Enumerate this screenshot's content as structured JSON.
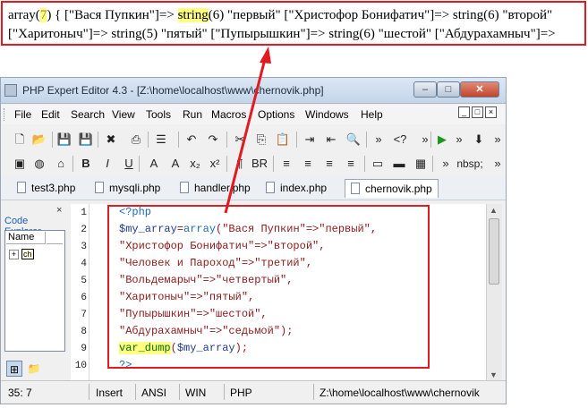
{
  "output": {
    "line1": [
      {
        "t": "array(",
        "c": ""
      },
      {
        "t": "7",
        "c": "hl"
      },
      {
        "t": ") { [\"Вася Пупкин\"]=> ",
        "c": ""
      },
      {
        "t": "string",
        "c": "hl2"
      },
      {
        "t": "(6) \"первый\" [\"Христофор Бонифатич\"]=> string(6) \"второй\"",
        "c": ""
      }
    ],
    "line2": "[\"Харитоныч\"]=> string(5) \"пятый\" [\"Пупырышкин\"]=> string(6) \"шестой\" [\"Абдурахамныч\"]=>"
  },
  "window": {
    "title": "PHP Expert Editor 4.3 - [Z:\\home\\localhost\\www\\chernovik.php]",
    "controls": {
      "minimize": "–",
      "maximize": "□",
      "close": "✕"
    }
  },
  "menu": [
    "File",
    "Edit",
    "Search",
    "View",
    "Tools",
    "Run",
    "Macros",
    "Options",
    "Windows",
    "Help"
  ],
  "mdi_controls": [
    "_",
    "□",
    "×"
  ],
  "toolbar1": [
    {
      "icon": "new-file-icon",
      "glyph": "🗋"
    },
    {
      "icon": "open-folder-icon",
      "glyph": "📂"
    },
    {
      "icon": "save-icon",
      "glyph": "💾"
    },
    {
      "icon": "save-all-icon",
      "glyph": "💾"
    },
    {
      "icon": "close-file-icon",
      "glyph": "✖"
    },
    {
      "icon": "print-icon",
      "glyph": "⎙"
    },
    {
      "icon": "list-icon",
      "glyph": "☰"
    },
    {
      "icon": "undo-icon",
      "glyph": "↶"
    },
    {
      "icon": "redo-icon",
      "glyph": "↷"
    },
    {
      "icon": "cut-icon",
      "glyph": "✂"
    },
    {
      "icon": "copy-icon",
      "glyph": "⎘"
    },
    {
      "icon": "paste-icon",
      "glyph": "📋"
    },
    {
      "icon": "indent-icon",
      "glyph": "⇥"
    },
    {
      "icon": "outdent-icon",
      "glyph": "⇤"
    },
    {
      "icon": "find-icon",
      "glyph": "🔍"
    },
    {
      "icon": "more-icon",
      "glyph": "»"
    },
    {
      "icon": "php-tag-icon",
      "glyph": "<?"
    },
    {
      "icon": "more-icon",
      "glyph": "»"
    },
    {
      "icon": "run-icon",
      "glyph": "▶"
    },
    {
      "icon": "more-icon",
      "glyph": "»"
    },
    {
      "icon": "debug-icon",
      "glyph": "⬇"
    },
    {
      "icon": "more-icon",
      "glyph": "»"
    }
  ],
  "toolbar2": [
    {
      "icon": "image-icon",
      "glyph": "▣"
    },
    {
      "icon": "globe-icon",
      "glyph": "◍"
    },
    {
      "icon": "link-icon",
      "glyph": "⌂"
    },
    {
      "icon": "bold-icon",
      "glyph": "B"
    },
    {
      "icon": "italic-icon",
      "glyph": "I"
    },
    {
      "icon": "underline-icon",
      "glyph": "U"
    },
    {
      "icon": "font-larger-icon",
      "glyph": "A"
    },
    {
      "icon": "font-smaller-icon",
      "glyph": "A"
    },
    {
      "icon": "subscript-icon",
      "glyph": "x₂"
    },
    {
      "icon": "superscript-icon",
      "glyph": "x²"
    },
    {
      "icon": "paragraph-icon",
      "glyph": "¶"
    },
    {
      "icon": "line-break-icon",
      "glyph": "BR"
    },
    {
      "icon": "align-left-icon",
      "glyph": "≡"
    },
    {
      "icon": "align-center-icon",
      "glyph": "≡"
    },
    {
      "icon": "align-right-icon",
      "glyph": "≡"
    },
    {
      "icon": "justify-icon",
      "glyph": "≡"
    },
    {
      "icon": "window-icon",
      "glyph": "▭"
    },
    {
      "icon": "input-icon",
      "glyph": "▬"
    },
    {
      "icon": "image-icon",
      "glyph": "▦"
    },
    {
      "icon": "more-icon",
      "glyph": "»"
    },
    {
      "icon": "nbsp-icon",
      "glyph": "nbsp;"
    },
    {
      "icon": "more-icon",
      "glyph": "»"
    }
  ],
  "tabs": [
    "test3.php",
    "mysqli.php",
    "handler.php",
    "index.php",
    "chernovik.php"
  ],
  "explorer": {
    "title": "Code Explorer",
    "col_name": "Name",
    "col_other": "",
    "node_label": "ch",
    "close": "×"
  },
  "line_numbers": [
    "1",
    "2",
    "3",
    "4",
    "5",
    "6",
    "7",
    "8",
    "9",
    "10"
  ],
  "code": [
    [
      {
        "t": "<?php",
        "c": "kw"
      }
    ],
    [
      {
        "t": "$my_array",
        "c": "var"
      },
      {
        "t": "=",
        "c": ""
      },
      {
        "t": "array",
        "c": "fn"
      },
      {
        "t": "(\"Вася Пупкин\"=>\"первый\",",
        "c": "str"
      }
    ],
    [
      {
        "t": "\"Христофор Бонифатич\"=>\"второй\",",
        "c": "str"
      }
    ],
    [
      {
        "t": "\"Человек и Пароход\"=>\"третий\",",
        "c": "str"
      }
    ],
    [
      {
        "t": "\"Вольдемарыч\"=>\"четвертый\",",
        "c": "str"
      }
    ],
    [
      {
        "t": "\"Харитоныч\"=>\"пятый\",",
        "c": "str"
      }
    ],
    [
      {
        "t": "\"Пупырышкин\"=>\"шестой\",",
        "c": "str"
      }
    ],
    [
      {
        "t": "\"Абдурахамныч\"=>\"седьмой\");",
        "c": "str"
      }
    ],
    [
      {
        "t": "var_dump",
        "c": "dq"
      },
      {
        "t": "(",
        "c": "str"
      },
      {
        "t": "$my_array",
        "c": "var"
      },
      {
        "t": ");",
        "c": "str"
      }
    ],
    [
      {
        "t": "?>",
        "c": "kw"
      }
    ]
  ],
  "status": {
    "position": "35: 7",
    "mode": "Insert",
    "encoding": "ANSI",
    "line_ending": "WIN",
    "language": "PHP",
    "path": "Z:\\home\\localhost\\www\\chernovik"
  },
  "colors": {
    "annotation": "#e11b22",
    "highlight": "#ffff80"
  }
}
